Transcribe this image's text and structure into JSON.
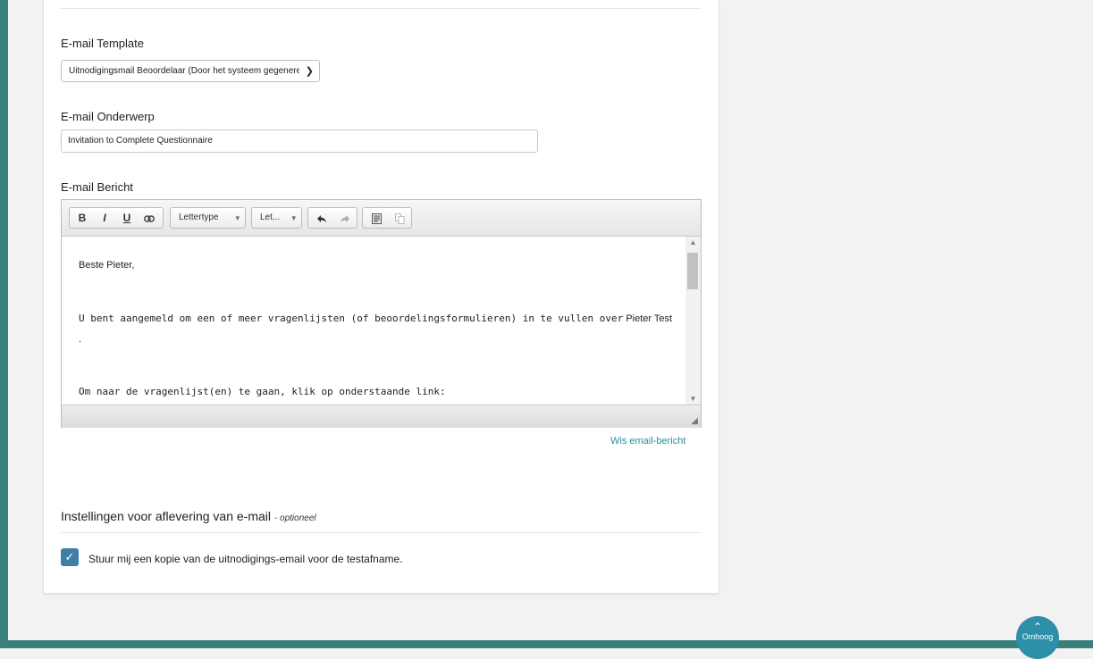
{
  "form": {
    "template_label": "E-mail Template",
    "template_value": "Uitnodigingsmail Beoordelaar (Door het systeem gegenereerd)",
    "subject_label": "E-mail Onderwerp",
    "subject_value": "Invitation to Complete Questionnaire",
    "message_label": "E-mail Bericht"
  },
  "editor": {
    "toolbar": {
      "bold": "B",
      "italic": "I",
      "underline": "U",
      "font_combo": "Lettertype",
      "size_combo": "Let..."
    },
    "content": {
      "greeting": "Beste Pieter,",
      "line1": "U bent aangemeld om een of meer vragenlijsten (of beoordelingsformulieren) in te vullen over",
      "line1_name": "Pieter Test",
      "line1_dot": ".",
      "line2": "Om naar de vragenlijst(en) te gaan, klik op onderstaande link:"
    }
  },
  "clear_link": "Wis email-bericht",
  "delivery": {
    "title": "Instellingen voor aflevering van e-mail",
    "optional": "- optioneel",
    "copy_label": "Stuur mij een kopie van de uitnodigings-email voor de testafname.",
    "copy_checked": true
  },
  "back_to_top": "Omhoog",
  "colors": {
    "sidebar": "#3b7f7b",
    "link": "#2b8aa0",
    "checkbox": "#3f7fa6",
    "back_button": "#2d8fa8"
  }
}
